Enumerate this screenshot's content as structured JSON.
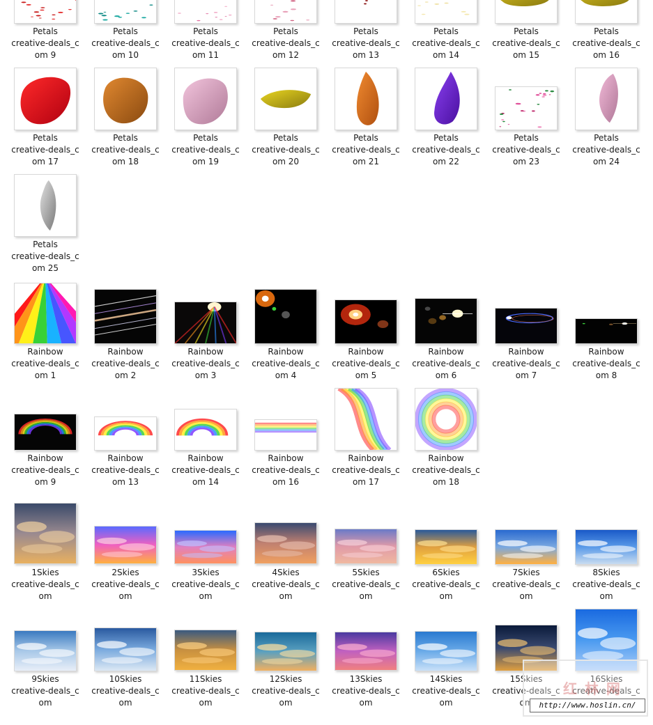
{
  "items": [
    {
      "name": "petals-9",
      "lines": [
        "Petals",
        "creative-deals_c",
        "om 9"
      ],
      "thumb": "petals-scatter-red"
    },
    {
      "name": "petals-10",
      "lines": [
        "Petals",
        "creative-deals_c",
        "om 10"
      ],
      "thumb": "petals-teal"
    },
    {
      "name": "petals-11",
      "lines": [
        "Petals",
        "creative-deals_c",
        "om 11"
      ],
      "thumb": "petals-pink-sparse"
    },
    {
      "name": "petals-12",
      "lines": [
        "Petals",
        "creative-deals_c",
        "om 12"
      ],
      "thumb": "petals-pink"
    },
    {
      "name": "petals-13",
      "lines": [
        "Petals",
        "creative-deals_c",
        "om 13"
      ],
      "thumb": "petals-darkred"
    },
    {
      "name": "petals-14",
      "lines": [
        "Petals",
        "creative-deals_c",
        "om 14"
      ],
      "thumb": "petals-cream"
    },
    {
      "name": "petals-15",
      "lines": [
        "Petals",
        "creative-deals_c",
        "om 15"
      ],
      "thumb": "petal-yellow-big"
    },
    {
      "name": "petals-16",
      "lines": [
        "Petals",
        "creative-deals_c",
        "om 16"
      ],
      "thumb": "petal-yellow-big"
    },
    {
      "name": "petals-17",
      "lines": [
        "Petals",
        "creative-deals_c",
        "om 17"
      ],
      "thumb": "petal-red"
    },
    {
      "name": "petals-18",
      "lines": [
        "Petals",
        "creative-deals_c",
        "om 18"
      ],
      "thumb": "petal-orange-brown"
    },
    {
      "name": "petals-19",
      "lines": [
        "Petals",
        "creative-deals_c",
        "om 19"
      ],
      "thumb": "petal-pink-round"
    },
    {
      "name": "petals-20",
      "lines": [
        "Petals",
        "creative-deals_c",
        "om 20"
      ],
      "thumb": "petal-yellow-curl"
    },
    {
      "name": "petals-21",
      "lines": [
        "Petals",
        "creative-deals_c",
        "om 21"
      ],
      "thumb": "petal-orange-tall"
    },
    {
      "name": "petals-22",
      "lines": [
        "Petals",
        "creative-deals_c",
        "om 22"
      ],
      "thumb": "petal-purple"
    },
    {
      "name": "petals-23",
      "lines": [
        "Petals",
        "creative-deals_c",
        "om 23"
      ],
      "thumb": "petals-mixed"
    },
    {
      "name": "petals-24",
      "lines": [
        "Petals",
        "creative-deals_c",
        "om 24"
      ],
      "thumb": "petal-pink-tall"
    },
    {
      "name": "petals-25",
      "lines": [
        "Petals",
        "creative-deals_c",
        "om 25"
      ],
      "thumb": "petal-grey"
    },
    {
      "name": "rainbow-1",
      "lines": [
        "Rainbow",
        "creative-deals_c",
        "om 1"
      ],
      "thumb": "rb-rays"
    },
    {
      "name": "rainbow-2",
      "lines": [
        "Rainbow",
        "creative-deals_c",
        "om 2"
      ],
      "thumb": "rb-streaks"
    },
    {
      "name": "rainbow-3",
      "lines": [
        "Rainbow",
        "creative-deals_c",
        "om 3"
      ],
      "thumb": "rb-burst"
    },
    {
      "name": "rainbow-4",
      "lines": [
        "Rainbow",
        "creative-deals_c",
        "om 4"
      ],
      "thumb": "rb-flare-orange"
    },
    {
      "name": "rainbow-5",
      "lines": [
        "Rainbow",
        "creative-deals_c",
        "om 5"
      ],
      "thumb": "rb-sun-red"
    },
    {
      "name": "rainbow-6",
      "lines": [
        "Rainbow",
        "creative-deals_c",
        "om 6"
      ],
      "thumb": "rb-flare-bokeh"
    },
    {
      "name": "rainbow-7",
      "lines": [
        "Rainbow",
        "creative-deals_c",
        "om 7"
      ],
      "thumb": "rb-ring-blue"
    },
    {
      "name": "rainbow-8",
      "lines": [
        "Rainbow",
        "creative-deals_c",
        "om 8"
      ],
      "thumb": "rb-star"
    },
    {
      "name": "rainbow-9",
      "lines": [
        "Rainbow",
        "creative-deals_c",
        "om 9"
      ],
      "thumb": "rb-arc-dark"
    },
    {
      "name": "rainbow-13",
      "lines": [
        "Rainbow",
        "creative-deals_c",
        "om 13"
      ],
      "thumb": "rb-arc-soft"
    },
    {
      "name": "rainbow-14",
      "lines": [
        "Rainbow",
        "creative-deals_c",
        "om 14"
      ],
      "thumb": "rb-arc-half"
    },
    {
      "name": "rainbow-16",
      "lines": [
        "Rainbow",
        "creative-deals_c",
        "om 16"
      ],
      "thumb": "rb-band"
    },
    {
      "name": "rainbow-17",
      "lines": [
        "Rainbow",
        "creative-deals_c",
        "om 17"
      ],
      "thumb": "rb-curve"
    },
    {
      "name": "rainbow-18",
      "lines": [
        "Rainbow",
        "creative-deals_c",
        "om 18"
      ],
      "thumb": "rb-halo"
    },
    {
      "name": "skies-1",
      "lines": [
        "1Skies",
        "creative-deals_c",
        "om"
      ],
      "thumb": "sky-dusk"
    },
    {
      "name": "skies-2",
      "lines": [
        "2Skies",
        "creative-deals_c",
        "om"
      ],
      "thumb": "sky-magenta"
    },
    {
      "name": "skies-3",
      "lines": [
        "3Skies",
        "creative-deals_c",
        "om"
      ],
      "thumb": "sky-blue-pink"
    },
    {
      "name": "skies-4",
      "lines": [
        "4Skies",
        "creative-deals_c",
        "om"
      ],
      "thumb": "sky-storm"
    },
    {
      "name": "skies-5",
      "lines": [
        "5Skies",
        "creative-deals_c",
        "om"
      ],
      "thumb": "sky-pastel"
    },
    {
      "name": "skies-6",
      "lines": [
        "6Skies",
        "creative-deals_c",
        "om"
      ],
      "thumb": "sky-golden"
    },
    {
      "name": "skies-7",
      "lines": [
        "7Skies",
        "creative-deals_c",
        "om"
      ],
      "thumb": "sky-sunset-blue"
    },
    {
      "name": "skies-8",
      "lines": [
        "8Skies",
        "creative-deals_c",
        "om"
      ],
      "thumb": "sky-day"
    },
    {
      "name": "skies-9",
      "lines": [
        "9Skies",
        "creative-deals_c",
        "om"
      ],
      "thumb": "sky-sun-clouds"
    },
    {
      "name": "skies-10",
      "lines": [
        "10Skies",
        "creative-deals_c",
        "om"
      ],
      "thumb": "sky-cloudy"
    },
    {
      "name": "skies-11",
      "lines": [
        "11Skies",
        "creative-deals_c",
        "om"
      ],
      "thumb": "sky-amber"
    },
    {
      "name": "skies-12",
      "lines": [
        "12Skies",
        "creative-deals_c",
        "om"
      ],
      "thumb": "sky-teal-gold"
    },
    {
      "name": "skies-13",
      "lines": [
        "13Skies",
        "creative-deals_c",
        "om"
      ],
      "thumb": "sky-violet"
    },
    {
      "name": "skies-14",
      "lines": [
        "14Skies",
        "creative-deals_c",
        "om"
      ],
      "thumb": "sky-cumulus"
    },
    {
      "name": "skies-15",
      "lines": [
        "15Skies",
        "creative-deals_c",
        "om"
      ],
      "thumb": "sky-night-gold"
    },
    {
      "name": "skies-16",
      "lines": [
        "16Skies",
        "creative-deals_c",
        "om"
      ],
      "thumb": "sky-bright"
    }
  ],
  "watermark": {
    "logo_text": "红  林  网",
    "url": "http://www.hoslin.cn/"
  }
}
